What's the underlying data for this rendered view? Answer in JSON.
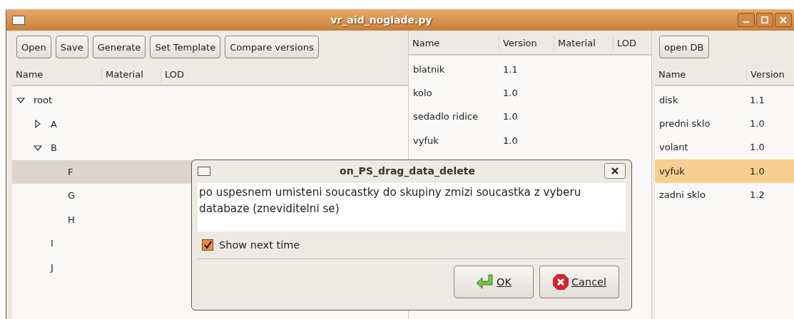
{
  "window": {
    "title": "vr_aid_noglade.py"
  },
  "toolbar": [
    "Open",
    "Save",
    "Generate",
    "Set Template",
    "Compare versions"
  ],
  "tree": {
    "columns": [
      "Name",
      "Material",
      "LOD"
    ],
    "nodes": [
      {
        "label": "root",
        "expanded": true,
        "selected": false,
        "children": [
          {
            "label": "A",
            "expanded": false,
            "selected": false
          },
          {
            "label": "B",
            "expanded": true,
            "selected": false,
            "children": [
              {
                "label": "F",
                "selected": true
              },
              {
                "label": "G",
                "selected": false
              },
              {
                "label": "H",
                "selected": false
              }
            ]
          },
          {
            "label": "I",
            "selected": false
          },
          {
            "label": "J",
            "selected": false
          }
        ]
      }
    ]
  },
  "parts_table": {
    "columns": [
      "Name",
      "Version",
      "Material",
      "LOD"
    ],
    "rows": [
      {
        "name": "blatnik",
        "version": "1.1"
      },
      {
        "name": "kolo",
        "version": "1.0"
      },
      {
        "name": "sedadlo ridice",
        "version": "1.0"
      },
      {
        "name": "vyfuk",
        "version": "1.0"
      }
    ]
  },
  "database": {
    "button": "open DB",
    "columns": [
      "Name",
      "Version"
    ],
    "rows": [
      {
        "name": "disk",
        "version": "1.1",
        "selected": false
      },
      {
        "name": "predni sklo",
        "version": "1.0",
        "selected": false
      },
      {
        "name": "volant",
        "version": "1.0",
        "selected": false
      },
      {
        "name": "vyfuk",
        "version": "1.0",
        "selected": true
      },
      {
        "name": "zadni sklo",
        "version": "1.2",
        "selected": false
      }
    ]
  },
  "dialog": {
    "title": "on_PS_drag_data_delete",
    "message": "po uspesnem umisteni soucastky do skupiny zmizi soucastka z vyberu databaze (zneviditelni se)",
    "checkbox": {
      "label": "Show next time",
      "checked": true
    },
    "buttons": [
      {
        "kind": "ok",
        "label": "OK"
      },
      {
        "kind": "cancel",
        "label": "Cancel"
      }
    ]
  }
}
